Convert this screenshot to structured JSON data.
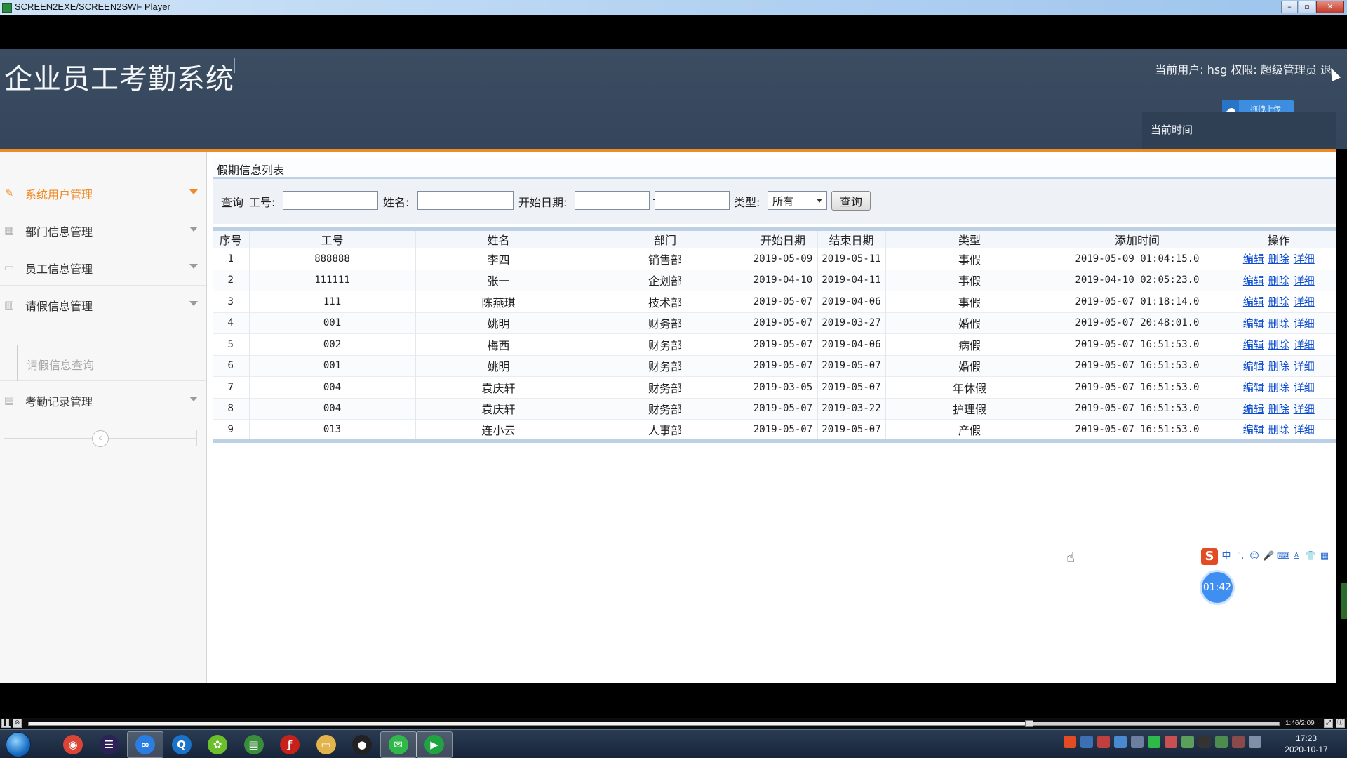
{
  "window": {
    "title": "SCREEN2EXE/SCREEN2SWF Player",
    "buttons": [
      "–",
      "▫",
      "✕"
    ]
  },
  "header": {
    "system_title": "企业员工考勤系统",
    "user_info": "当前用户: hsg 权限: 超级管理员 退",
    "cloud_upload_label": "拖拽上传",
    "current_time_label": "当前时间"
  },
  "sidebar": {
    "items": [
      {
        "label": "系统用户管理",
        "icon": "pencil-icon",
        "active": true
      },
      {
        "label": "部门信息管理",
        "icon": "grid-icon",
        "active": false
      },
      {
        "label": "员工信息管理",
        "icon": "id-card-icon",
        "active": false
      },
      {
        "label": "请假信息管理",
        "icon": "columns-icon",
        "active": false
      },
      {
        "label": "考勤记录管理",
        "icon": "calendar-icon",
        "active": false
      }
    ],
    "subitem": "请假信息查询",
    "collapse_glyph": "‹"
  },
  "panel": {
    "title": "假期信息列表"
  },
  "search": {
    "query_label": "查询",
    "emp_no_label": "工号:",
    "emp_no_value": "",
    "name_label": "姓名:",
    "name_value": "",
    "start_date_label": "开始日期:",
    "start_date_from": "",
    "start_date_to": "",
    "type_label": "类型:",
    "type_value": "所有",
    "submit_label": "查询"
  },
  "table": {
    "columns": [
      "序号",
      "工号",
      "姓名",
      "部门",
      "开始日期",
      "结束日期",
      "类型",
      "添加时间",
      "操作"
    ],
    "rows": [
      [
        "1",
        "888888",
        "李四",
        "销售部",
        "2019-05-09",
        "2019-05-11",
        "事假",
        "2019-05-09 01:04:15.0"
      ],
      [
        "2",
        "111111",
        "张一",
        "企划部",
        "2019-04-10",
        "2019-04-11",
        "事假",
        "2019-04-10 02:05:23.0"
      ],
      [
        "3",
        "111",
        "陈燕琪",
        "技术部",
        "2019-05-07",
        "2019-04-06",
        "事假",
        "2019-05-07 01:18:14.0"
      ],
      [
        "4",
        "001",
        "姚明",
        "财务部",
        "2019-05-07",
        "2019-03-27",
        "婚假",
        "2019-05-07 20:48:01.0"
      ],
      [
        "5",
        "002",
        "梅西",
        "财务部",
        "2019-05-07",
        "2019-04-06",
        "病假",
        "2019-05-07 16:51:53.0"
      ],
      [
        "6",
        "001",
        "姚明",
        "财务部",
        "2019-05-07",
        "2019-05-07",
        "婚假",
        "2019-05-07 16:51:53.0"
      ],
      [
        "7",
        "004",
        "袁庆轩",
        "财务部",
        "2019-03-05",
        "2019-05-07",
        "年休假",
        "2019-05-07 16:51:53.0"
      ],
      [
        "8",
        "004",
        "袁庆轩",
        "财务部",
        "2019-05-07",
        "2019-03-22",
        "护理假",
        "2019-05-07 16:51:53.0"
      ],
      [
        "9",
        "013",
        "连小云",
        "人事部",
        "2019-05-07",
        "2019-05-07",
        "产假",
        "2019-05-07 16:51:53.0"
      ]
    ],
    "actions": [
      "编辑",
      "删除",
      "详细"
    ]
  },
  "overlay": {
    "ime_logo": "S",
    "ime_icons": [
      "中",
      "°,",
      "☺",
      "🎤",
      "⌨",
      "♙",
      "👕",
      "▦"
    ],
    "timer": "01:42"
  },
  "player": {
    "progress": 0.8,
    "time": "1:46/2:09"
  },
  "taskbar": {
    "apps": [
      {
        "icon": "chrome-icon",
        "glyph": "◉",
        "color": "#db4437",
        "active": false
      },
      {
        "icon": "eclipse-icon",
        "glyph": "☰",
        "color": "#2c2255",
        "active": false
      },
      {
        "icon": "baidu-netdisk-icon",
        "glyph": "∞",
        "color": "#2a7de1",
        "active": true
      },
      {
        "icon": "browser-q-icon",
        "glyph": "Q",
        "color": "#1a73c9",
        "active": false
      },
      {
        "icon": "leaf-app-icon",
        "glyph": "✿",
        "color": "#6abf2b",
        "active": false
      },
      {
        "icon": "spreadsheet-icon",
        "glyph": "▤",
        "color": "#3a8d3a",
        "active": false
      },
      {
        "icon": "flash-icon",
        "glyph": "ƒ",
        "color": "#c8211b",
        "active": false
      },
      {
        "icon": "folder-icon",
        "glyph": "▭",
        "color": "#e3b44b",
        "active": false
      },
      {
        "icon": "qq-icon",
        "glyph": "●",
        "color": "#222222",
        "active": false
      },
      {
        "icon": "wechat-icon",
        "glyph": "✉",
        "color": "#2fb94a",
        "active": true
      },
      {
        "icon": "recorder-icon",
        "glyph": "▶",
        "color": "#1ea541",
        "active": true
      }
    ],
    "clock_time": "17:23",
    "clock_date": "2020-10-17"
  },
  "colors": {
    "accent": "#f08a24",
    "header_bg": "#3c4d62",
    "link": "#0a4bd1"
  }
}
